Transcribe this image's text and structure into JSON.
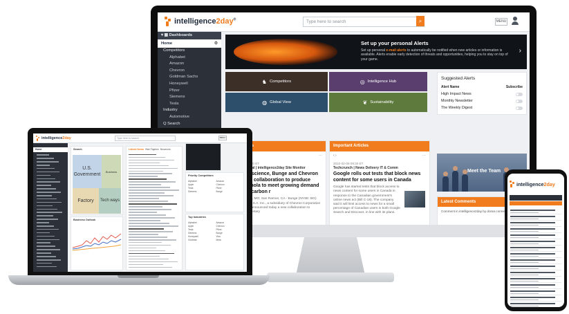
{
  "brand": {
    "name_main": "intelligence",
    "name_accent": "2day",
    "reg": "®",
    "accent": "#f07c1e",
    "dark": "#2b3039"
  },
  "desktop": {
    "search_placeholder": "Type here to search",
    "menu_button": "MENU",
    "sidebar": {
      "section": "Dashboards",
      "home": "Home",
      "items": [
        {
          "label": "Competitors",
          "sub": false
        },
        {
          "label": "Alphabet",
          "sub": true
        },
        {
          "label": "Amazon",
          "sub": true
        },
        {
          "label": "Chevron",
          "sub": true
        },
        {
          "label": "Goldman Sachs",
          "sub": true
        },
        {
          "label": "Honeywell",
          "sub": true
        },
        {
          "label": "Pfizer",
          "sub": true
        },
        {
          "label": "Siemens",
          "sub": true
        },
        {
          "label": "Tesla",
          "sub": true
        },
        {
          "label": "Industry",
          "sub": false
        },
        {
          "label": "Automotive",
          "sub": true
        },
        {
          "label": "Q Search",
          "sub": false
        }
      ]
    },
    "banner": {
      "title": "Set up your personal Alerts",
      "text_before": "Set up personal ",
      "text_link": "e-mail alerts",
      "text_after": " to automatically be notified when new articles or information is available. Alerts enable early detection of threats and opportunities, helping you to stay on top of your game."
    },
    "tiles": [
      {
        "label": "Competitors",
        "icon": "chess-icon",
        "bg": "#3b2f28"
      },
      {
        "label": "Intelligence Hub",
        "icon": "hub-icon",
        "bg": "#5a3f6e"
      },
      {
        "label": "Global View",
        "icon": "globe-icon",
        "bg": "#2d4f6b"
      },
      {
        "label": "Sustainability",
        "icon": "leaf-icon",
        "bg": "#5e7a3d"
      }
    ],
    "suggested_alerts": {
      "title": "Suggested Alerts",
      "col_name": "Alert Name",
      "col_sub": "Subscribe",
      "rows": [
        "High Impact News",
        "Monthly Newsletter",
        "The Weekly Digest"
      ]
    },
    "panel_left": {
      "header": "Latest News",
      "date": "2022-02-09 11:00 ET",
      "source": "Venture Capital | intelligence2day Site Monitor",
      "title": "Nova agriscience, Bunge and Chevron announce collaboration to produce winter canola to meet growing demand for lower carbon r",
      "body": "Louis, St. Louis, MO; San Ramon, CA - Bunge (NYSE: BG) and Chevron U.S.A. Inc., a subsidiary of Chevron Corporation (NYSE: CVX), announced today a new collaboration to introduce proprietary"
    },
    "panel_right": {
      "header": "Important Articles",
      "date": "2022-02-09 09:30 ET",
      "source": "Techcrunch | News Delivery IT & Comm",
      "title": "Google rolls out tests that block news content for some users in Canada",
      "body": "Google has started tests that block access to news content for some users in Canada in response to the Canadian government's online news act (Bill C-18). The company said it will limit access to news for a small percentage of Canadian users in both Google Search and Discover, in line with its plans."
    },
    "team": {
      "label": "Meet the Team"
    },
    "comments": {
      "header": "Latest Comments",
      "line": "Comment in intelligence2day by doran.connelly@gmail.com"
    }
  },
  "laptop": {
    "search_placeholder": "Type here to search",
    "menu_button": "MENU",
    "home": "Home",
    "treemap_title": "Search",
    "treemap": [
      {
        "label": "U.S. Government",
        "bg": "#c2d4e8"
      },
      {
        "label": "Business",
        "bg": "#cdd9b7"
      },
      {
        "label": "Factory",
        "bg": "#e9d9b3"
      },
      {
        "label": "Tech ways",
        "bg": "#b4cfc1"
      }
    ],
    "line_chart_title": "Business Outlook",
    "news_tabs": [
      "Latest News",
      "Hot Topics",
      "Sources"
    ],
    "competitors_title": "Priority Competitors",
    "companies_title": "Top Industries",
    "companies": [
      "Alphabet",
      "Amazon",
      "Apple",
      "Chevron",
      "Tesla",
      "Pfizer",
      "Siemens",
      "Bunge",
      "Honeywell",
      "Visa",
      "Goldman",
      "Meta"
    ]
  }
}
